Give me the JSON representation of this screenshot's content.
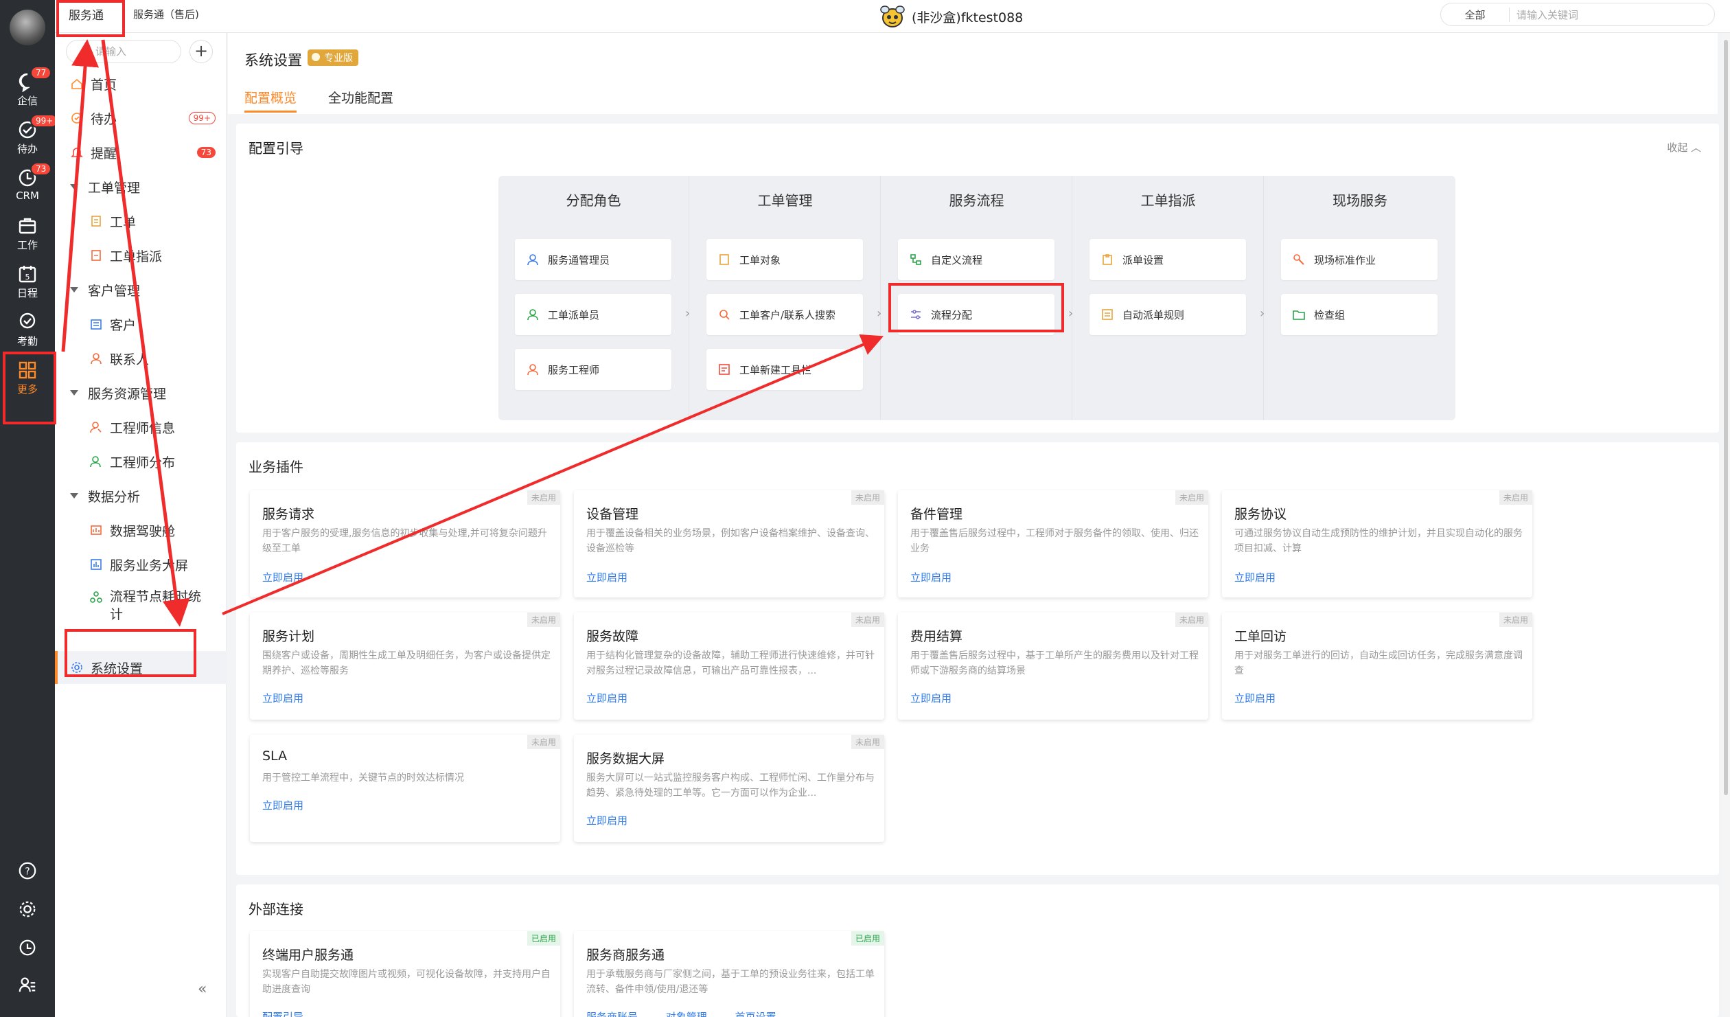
{
  "top": {
    "tab_active": "服务通",
    "tab_second": "服务通（售后)",
    "center_title": "(非沙盒)fktest088",
    "search_scope": "全部",
    "search_placeholder": "请输入关键词"
  },
  "rail": {
    "items": [
      {
        "label": "企信",
        "badge": "77",
        "icon": "chat-icon"
      },
      {
        "label": "待办",
        "badge": "99+",
        "icon": "todo-icon"
      },
      {
        "label": "CRM",
        "badge": "73",
        "icon": "crm-icon"
      },
      {
        "label": "工作",
        "badge": "",
        "icon": "briefcase-icon"
      },
      {
        "label": "日程",
        "badge": "",
        "icon": "calendar-icon"
      },
      {
        "label": "考勤",
        "badge": "",
        "icon": "attendance-icon"
      },
      {
        "label": "更多",
        "badge": "",
        "icon": "apps-grid-icon"
      }
    ]
  },
  "side": {
    "search_placeholder": "请输入",
    "add": "+",
    "items": [
      {
        "label": "首页",
        "count": "",
        "icon": "home-icon"
      },
      {
        "label": "待办",
        "count": "99+",
        "icon": "todo-icon"
      },
      {
        "label": "提醒",
        "count": "73",
        "icon": "bell-icon"
      },
      {
        "label": "工单管理",
        "count": "",
        "icon": "caret"
      },
      {
        "label": "工单",
        "count": "",
        "icon": "ticket-icon"
      },
      {
        "label": "工单指派",
        "count": "",
        "icon": "assign-icon"
      },
      {
        "label": "客户管理",
        "count": "",
        "icon": "caret"
      },
      {
        "label": "客户",
        "count": "",
        "icon": "customer-icon"
      },
      {
        "label": "联系人",
        "count": "",
        "icon": "contact-icon"
      },
      {
        "label": "服务资源管理",
        "count": "",
        "icon": "caret"
      },
      {
        "label": "工程师信息",
        "count": "",
        "icon": "engineer-icon"
      },
      {
        "label": "工程师分布",
        "count": "",
        "icon": "map-icon"
      },
      {
        "label": "数据分析",
        "count": "",
        "icon": "caret"
      },
      {
        "label": "数据驾驶舱",
        "count": "",
        "icon": "dashboard-icon"
      },
      {
        "label": "服务业务大屏",
        "count": "",
        "icon": "bar-chart-icon"
      },
      {
        "label": "流程节点耗时统计",
        "count": "",
        "icon": "flow-icon"
      },
      {
        "label": "系统设置",
        "count": "",
        "icon": "gear-icon"
      }
    ],
    "collapse": "«"
  },
  "main": {
    "title": "系统设置",
    "badge": "专业版",
    "tabs": [
      "配置概览",
      "全功能配置"
    ]
  },
  "guide": {
    "title": "配置引导",
    "collapse": "收起 ︿",
    "columns": [
      {
        "head": "分配角色",
        "cards": [
          "服务通管理员",
          "工单派单员",
          "服务工程师"
        ]
      },
      {
        "head": "工单管理",
        "cards": [
          "工单对象",
          "工单客户/联系人搜索",
          "工单新建工具栏"
        ]
      },
      {
        "head": "服务流程",
        "cards": [
          "自定义流程",
          "流程分配"
        ]
      },
      {
        "head": "工单指派",
        "cards": [
          "派单设置",
          "自动派单规则"
        ]
      },
      {
        "head": "现场服务",
        "cards": [
          "现场标准作业",
          "检查组"
        ]
      }
    ]
  },
  "plugins": {
    "title": "业务插件",
    "link": "立即启用",
    "tag": "未启用",
    "items": [
      {
        "name": "服务请求",
        "desc": "用于客户服务的受理,服务信息的初步收集与处理,并可将复杂问题升级至工单"
      },
      {
        "name": "设备管理",
        "desc": "用于覆盖设备相关的业务场景，例如客户设备档案维护、设备查询、设备巡检等"
      },
      {
        "name": "备件管理",
        "desc": "用于覆盖售后服务过程中，工程师对于服务备件的领取、使用、归还业务"
      },
      {
        "name": "服务协议",
        "desc": "可通过服务协议自动生成预防性的维护计划，并且实现自动化的服务项目扣减、计算"
      },
      {
        "name": "服务计划",
        "desc": "围绕客户或设备，周期性生成工单及明细任务，为客户或设备提供定期养护、巡检等服务"
      },
      {
        "name": "服务故障",
        "desc": "用于结构化管理复杂的设备故障，辅助工程师进行快速维修，并可针对服务过程记录故障信息，可输出产品可靠性报表，..."
      },
      {
        "name": "费用结算",
        "desc": "用于覆盖售后服务过程中，基于工单所产生的服务费用以及针对工程师或下游服务商的结算场景"
      },
      {
        "name": "工单回访",
        "desc": "用于对服务工单进行的回访，自动生成回访任务，完成服务满意度调查"
      },
      {
        "name": "SLA",
        "desc": "用于管控工单流程中，关键节点的时效达标情况"
      },
      {
        "name": "服务数据大屏",
        "desc": "服务大屏可以一站式监控服务客户构成、工程师忙闲、工作量分布与趋势、紧急待处理的工单等。它一方面可以作为企业..."
      }
    ]
  },
  "external": {
    "title": "外部连接",
    "tag": "已启用",
    "items": [
      {
        "name": "终端用户服务通",
        "desc": "实现客户自助提交故障图片或视频，可视化设备故障，并支持用户自助进度查询",
        "links": [
          "配置引导"
        ]
      },
      {
        "name": "服务商服务通",
        "desc": "用于承载服务商与厂家侧之间，基于工单的预设业务往来，包括工单流转、备件申领/使用/退还等",
        "links": [
          "服务商账号",
          "对象管理",
          "首页设置"
        ]
      }
    ]
  },
  "colors": {
    "accent": "#ff8a2a",
    "link": "#2f7be8",
    "annotation": "#f02b2b",
    "rail": "#2b2e33"
  }
}
